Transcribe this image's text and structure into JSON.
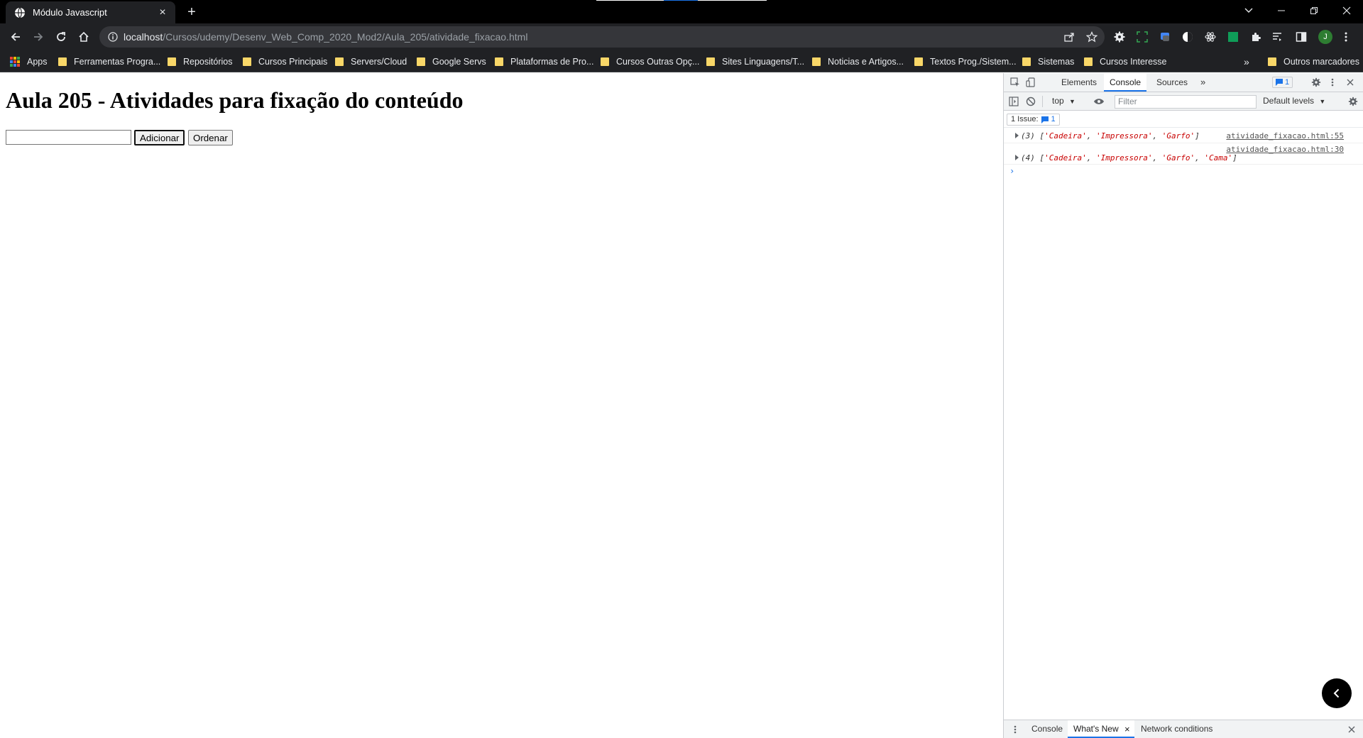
{
  "browser": {
    "tab_title": "Módulo Javascript",
    "tab_close": "×",
    "new_tab": "+",
    "url_host": "localhost",
    "url_path": "/Cursos/udemy/Desenv_Web_Comp_2020_Mod2/Aula_205/atividade_fixacao.html",
    "profile_initial": "J"
  },
  "bookmarks": {
    "apps": "Apps",
    "folders": [
      "Ferramentas Progra...",
      "Repositórios",
      "Cursos Principais",
      "Servers/Cloud",
      "Google Servs",
      "Plataformas de Pro...",
      "Cursos Outras Opç...",
      "Sites Linguagens/T...",
      "Noticias e Artigos...",
      "Textos Prog./Sistem...",
      "Sistemas",
      "Cursos Interesse"
    ],
    "overflow": "»",
    "other": "Outros marcadores"
  },
  "page": {
    "heading": "Aula 205 - Atividades para fixação do conteúdo",
    "input_value": "",
    "add_button": "Adicionar",
    "sort_button": "Ordenar"
  },
  "devtools": {
    "tabs": [
      "Elements",
      "Console",
      "Sources"
    ],
    "active_tab": "Console",
    "more_tabs": "»",
    "message_count": "1",
    "context": "top",
    "filter_placeholder": "Filter",
    "levels": "Default levels",
    "issues_label": "1 Issue:",
    "issues_count": "1",
    "logs": [
      {
        "count": "(3)",
        "items": [
          "'Cadeira'",
          "'Impressora'",
          "'Garfo'"
        ],
        "source": "atividade_fixacao.html:55"
      },
      {
        "count": "(4)",
        "items": [
          "'Cadeira'",
          "'Impressora'",
          "'Garfo'",
          "'Cama'"
        ],
        "source": "atividade_fixacao.html:30"
      }
    ],
    "prompt": "›",
    "drawer_tabs": [
      "Console",
      "What's New",
      "Network conditions"
    ],
    "drawer_active": "What's New",
    "drawer_tab_close": "×",
    "drawer_close": "×"
  },
  "colors": {
    "accent_blue": "#1a73e8",
    "string_red": "#c80000",
    "folder_yellow": "#f9d768",
    "chrome_dark": "#202124"
  }
}
